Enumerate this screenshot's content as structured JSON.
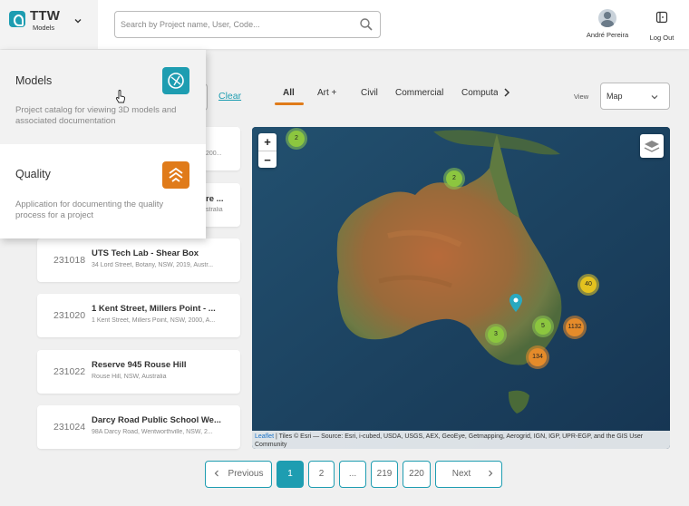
{
  "header": {
    "brand_title": "TTW",
    "brand_subtitle": "Models",
    "search_placeholder": "Search by Project name, User, Code...",
    "user_name": "André Pereira",
    "logout_label": "Log Out"
  },
  "toolbar": {
    "clear_label": "Clear",
    "tabs": [
      {
        "label": "All",
        "active": true
      },
      {
        "label": "Art +",
        "active": false
      },
      {
        "label": "Civil",
        "active": false
      },
      {
        "label": "Commercial",
        "active": false
      },
      {
        "label": "Computa",
        "active": false
      }
    ],
    "view_label": "View",
    "view_value": "Map"
  },
  "projects": [
    {
      "code": "",
      "title": "",
      "address": "200..."
    },
    {
      "code": "",
      "title": "re ...",
      "address": "stralia"
    },
    {
      "code": "231018",
      "title": "UTS Tech Lab - Shear Box",
      "address": "34 Lord Street, Botany, NSW, 2019, Austr..."
    },
    {
      "code": "231020",
      "title": "1 Kent Street, Millers Point - ...",
      "address": "1 Kent Street, Millers Point, NSW, 2000, A..."
    },
    {
      "code": "231022",
      "title": "Reserve 945 Rouse Hill",
      "address": "Rouse Hill, NSW, Australia"
    },
    {
      "code": "231024",
      "title": "Darcy Road Public School We...",
      "address": "98A Darcy Road, Wentworthville, NSW, 2..."
    }
  ],
  "map": {
    "zoom_in": "+",
    "zoom_out": "−",
    "clusters": [
      {
        "count": "2",
        "color": "green"
      },
      {
        "count": "2",
        "color": "green"
      },
      {
        "count": "40",
        "color": "yellow"
      },
      {
        "count": "5",
        "color": "green"
      },
      {
        "count": "1132",
        "color": "orange"
      },
      {
        "count": "3",
        "color": "green"
      },
      {
        "count": "134",
        "color": "orange"
      }
    ],
    "attribution_leaflet": "Leaflet",
    "attribution_text": " | Tiles © Esri — Source: Esri, i-cubed, USDA, USGS, AEX, GeoEye, Getmapping, Aerogrid, IGN, IGP, UPR-EGP, and the GIS User Community"
  },
  "pagination": {
    "previous": "Previous",
    "pages": [
      "1",
      "2",
      "...",
      "219",
      "220"
    ],
    "next": "Next",
    "active_page": "1"
  },
  "dropdown": {
    "items": [
      {
        "title": "Models",
        "description": "Project catalog for viewing 3D models and associated documentation",
        "icon_color": "#1e9db1"
      },
      {
        "title": "Quality",
        "description": "Application for documenting the quality process for a project",
        "icon_color": "#e07b1a"
      }
    ]
  },
  "colors": {
    "accent": "#1e9db1",
    "tab_underline": "#e07b1a"
  }
}
